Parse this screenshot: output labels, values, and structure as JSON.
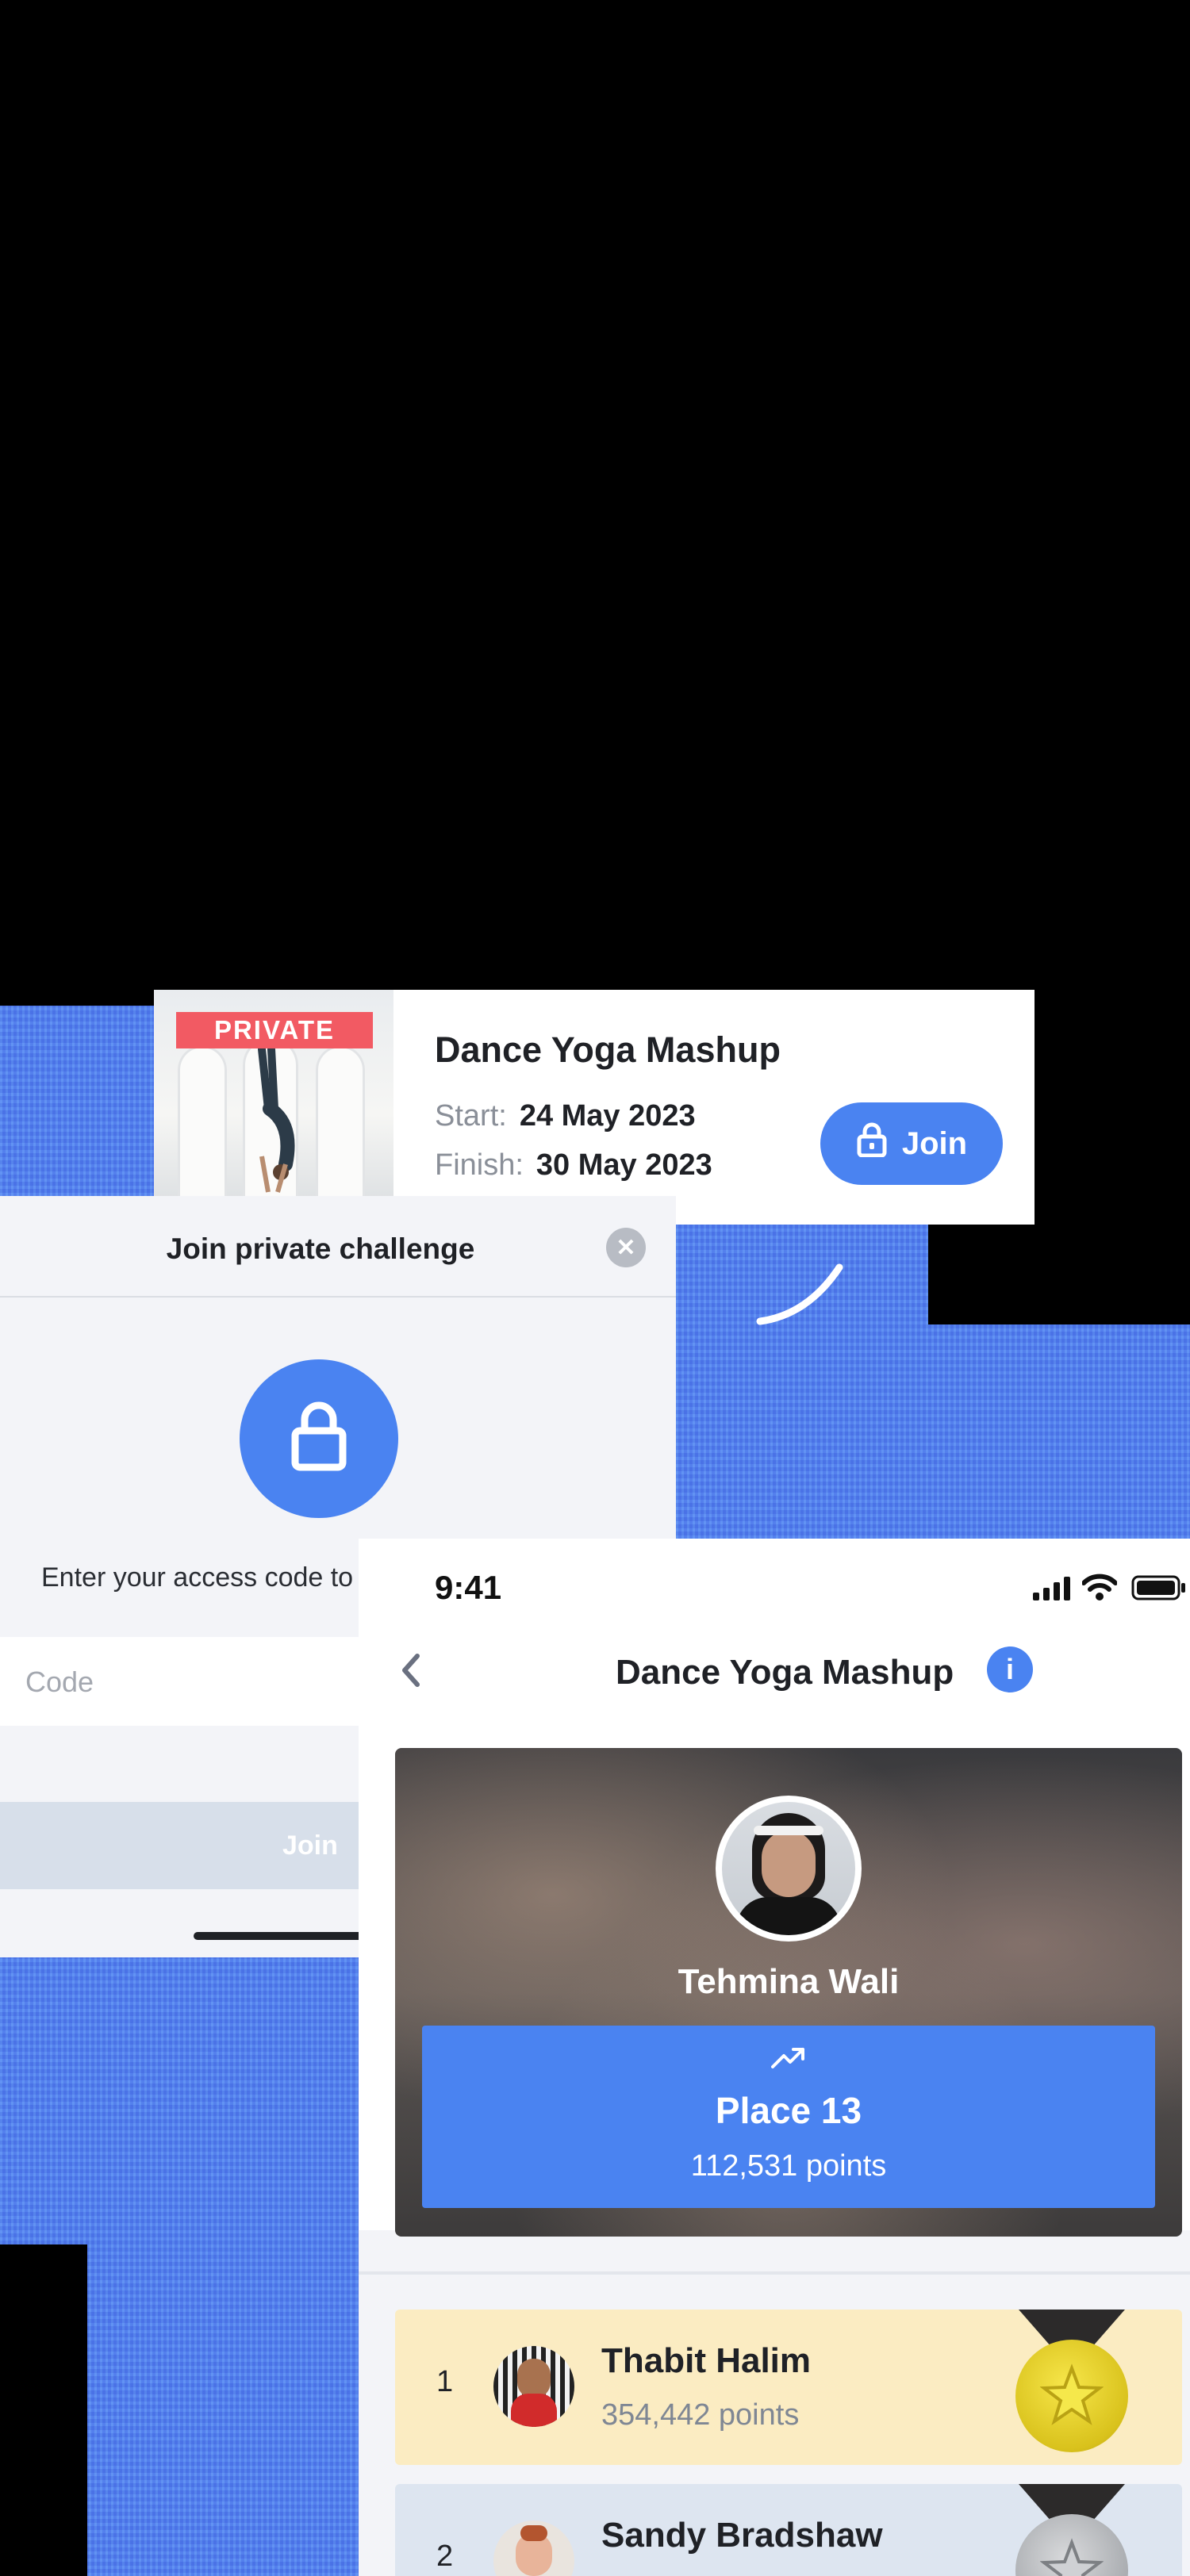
{
  "colors": {
    "accent": "#4a83f1",
    "private_badge": "#f25a63",
    "first_row": "#fbecc2",
    "second_row": "#dde5f0"
  },
  "card": {
    "badge": "PRIVATE",
    "title": "Dance Yoga Mashup",
    "start_label": "Start:",
    "start_value": "24 May 2023",
    "finish_label": "Finish:",
    "finish_value": "30 May 2023",
    "join_label": "Join",
    "join_icon": "lock-icon"
  },
  "modal": {
    "title": "Join private challenge",
    "close_icon": "close-icon",
    "lock_icon": "lock-icon",
    "prompt": "Enter your access code to",
    "code_placeholder": "Code",
    "join_label": "Join"
  },
  "phone": {
    "status_time": "9:41",
    "nav_title": "Dance Yoga Mashup",
    "user_name": "Tehmina Wali",
    "place_label": "Place 13",
    "points": "112,531 points",
    "leaderboard": [
      {
        "rank": "1",
        "name": "Thabit Halim",
        "points": "354,442 points",
        "medal": "gold-medal-icon"
      },
      {
        "rank": "2",
        "name": "Sandy Bradshaw",
        "points": "",
        "medal": "silver-medal-icon"
      }
    ]
  }
}
